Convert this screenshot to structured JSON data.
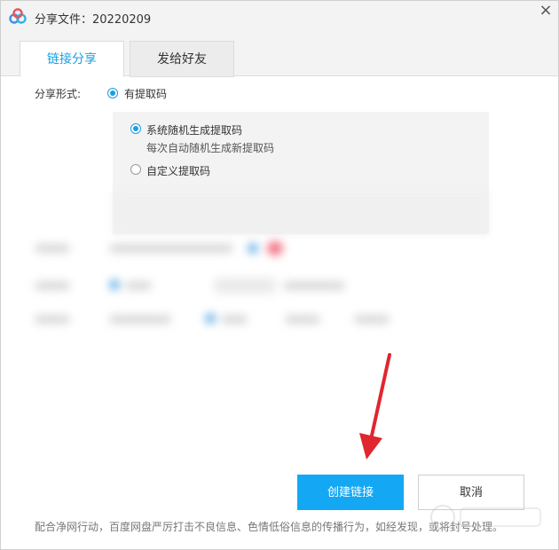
{
  "window": {
    "title": "分享文件：20220209"
  },
  "tabs": [
    {
      "label": "链接分享",
      "active": true
    },
    {
      "label": "发给好友",
      "active": false
    }
  ],
  "share_form": {
    "label": "分享形式:",
    "option": "有提取码"
  },
  "code_options": {
    "random": {
      "label": "系统随机生成提取码",
      "hint": "每次自动随机生成新提取码",
      "selected": true
    },
    "custom": {
      "label": "自定义提取码",
      "selected": false
    }
  },
  "buttons": {
    "create": "创建链接",
    "cancel": "取消"
  },
  "footer": {
    "notice": "配合净网行动，百度网盘严厉打击不良信息、色情低俗信息的传播行为，如经发现，或将封号处理。"
  },
  "colors": {
    "accent": "#1a9ee0",
    "primary_button": "#14a8f4",
    "arrow": "#e0262e"
  }
}
